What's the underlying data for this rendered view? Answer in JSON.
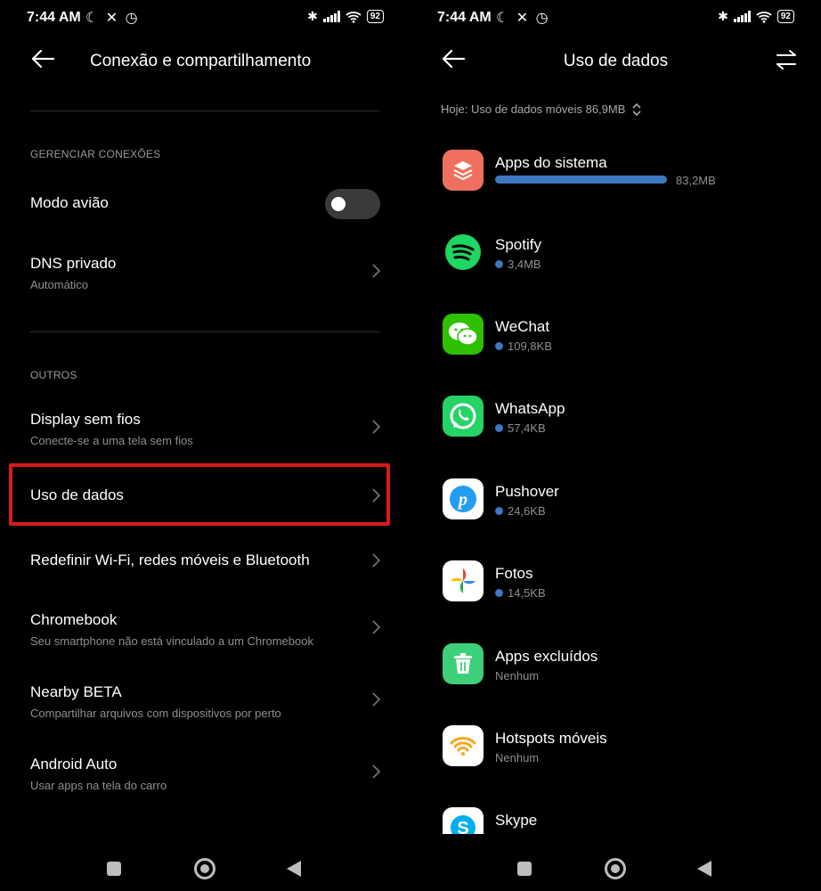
{
  "left": {
    "status": {
      "time": "7:44 AM",
      "battery": "92"
    },
    "title": "Conexão e compartilhamento",
    "section1": "GERENCIAR CONEXÕES",
    "airplane_label": "Modo avião",
    "dns": {
      "title": "DNS privado",
      "subtitle": "Automático"
    },
    "section2": "OUTROS",
    "items": [
      {
        "title": "Display sem fios",
        "subtitle": "Conecte-se a uma tela sem fios"
      },
      {
        "title": "Uso de dados",
        "subtitle": ""
      },
      {
        "title": "Redefinir Wi-Fi, redes móveis e Bluetooth",
        "subtitle": ""
      },
      {
        "title": "Chromebook",
        "subtitle": "Seu smartphone não está vinculado a um Chromebook"
      },
      {
        "title": "Nearby BETA",
        "subtitle": "Compartilhar arquivos com dispositivos por perto"
      },
      {
        "title": "Android Auto",
        "subtitle": "Usar apps na tela do carro"
      }
    ]
  },
  "right": {
    "status": {
      "time": "7:44 AM",
      "battery": "92"
    },
    "title": "Uso de dados",
    "summary": "Hoje: Uso de dados móveis 86,9MB",
    "apps": [
      {
        "name": "Apps do sistema",
        "usage": "83,2MB",
        "icon": "system-apps-icon"
      },
      {
        "name": "Spotify",
        "usage": "3,4MB",
        "icon": "spotify-icon"
      },
      {
        "name": "WeChat",
        "usage": "109,8KB",
        "icon": "wechat-icon"
      },
      {
        "name": "WhatsApp",
        "usage": "57,4KB",
        "icon": "whatsapp-icon"
      },
      {
        "name": "Pushover",
        "usage": "24,6KB",
        "icon": "pushover-icon"
      },
      {
        "name": "Fotos",
        "usage": "14,5KB",
        "icon": "photos-icon"
      },
      {
        "name": "Apps excluídos",
        "usage": "Nenhum",
        "icon": "trash-icon"
      },
      {
        "name": "Hotspots móveis",
        "usage": "Nenhum",
        "icon": "hotspot-icon"
      },
      {
        "name": "Skype",
        "usage": "",
        "icon": "skype-icon"
      }
    ]
  },
  "colors": {
    "accent": "#3d77c0",
    "highlight": "#d71a1a",
    "background": "#000000"
  }
}
